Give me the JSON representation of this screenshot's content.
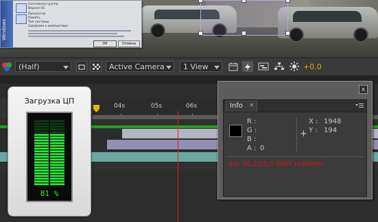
{
  "screenshot_window": {
    "side_label": "Windows",
    "lines": [
      "Системная группа",
      "Версия ОС",
      "Процессор",
      "Память",
      "Тип системы",
      "Сведения о компьютере"
    ],
    "ok_label": "OK",
    "cancel_label": "Отмена"
  },
  "viewer_toolbar": {
    "resolution": "(Half)",
    "camera": "Active Camera",
    "views": "1 View",
    "exposure": "+0.0"
  },
  "timeline": {
    "ticks": [
      "04s",
      "05s",
      "06s"
    ]
  },
  "cpu_gadget": {
    "title": "Загрузка ЦП",
    "percent_label": "81 %",
    "load_fraction": 0.81
  },
  "info_panel": {
    "tab_label": "Info",
    "tab_close": "×",
    "window_close": "x",
    "r_label": "R :",
    "g_label": "G :",
    "b_label": "B :",
    "a_label": "A :",
    "a_value": "0",
    "x_label": "X :",
    "x_value": "1948",
    "y_label": "Y :",
    "y_value": "194",
    "status": "fps: 20,1/25,0 (NOT realtime)",
    "status_color": "#d01818"
  },
  "colors": {
    "playhead": "#e02020",
    "meter_green": "#2ff040",
    "exposure": "#d9b200"
  }
}
